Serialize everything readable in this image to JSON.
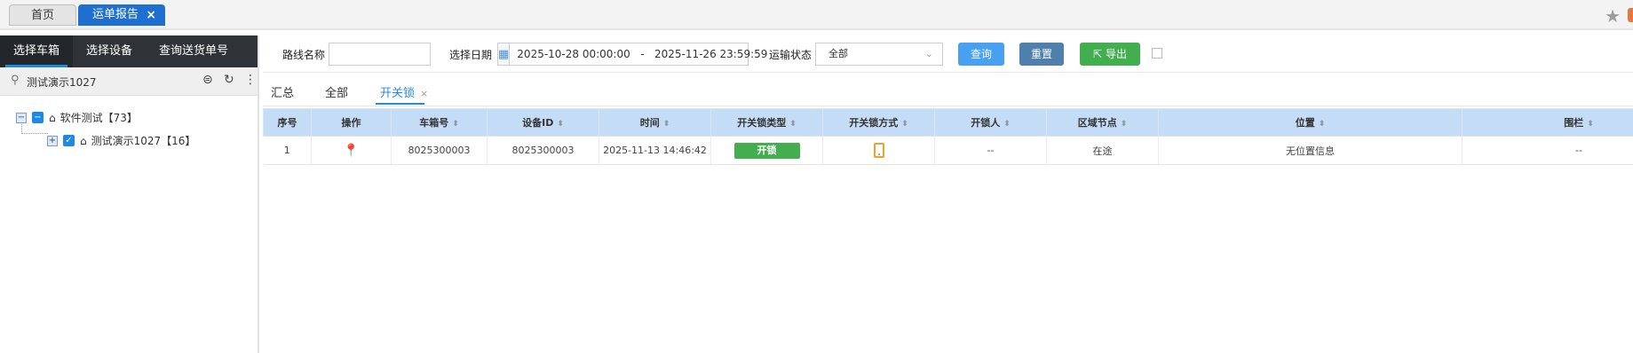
{
  "top_tabs": [
    {
      "label": "首页"
    },
    {
      "label": "运单报告",
      "close": "×"
    }
  ],
  "left": {
    "tabs": [
      "选择车箱",
      "选择设备",
      "查询送货单号"
    ],
    "search_text": "测试演示1027",
    "tree": [
      {
        "label": "软件测试【73】",
        "expander": "−",
        "check": "−"
      },
      {
        "label": "测试演示1027【16】",
        "expander": "+",
        "check": "✓"
      }
    ]
  },
  "filter": {
    "route_label": "路线名称",
    "route_value": "",
    "date_label": "选择日期",
    "date_range": "2025-10-28 00:00:00   -   2025-11-26 23:59:59",
    "status_label": "运输状态",
    "status_value": "全部",
    "query_label": "查询",
    "reset_label": "重置",
    "export_label": "导出"
  },
  "subtabs": [
    {
      "label": "汇总"
    },
    {
      "label": "全部"
    },
    {
      "label": "开关锁",
      "close": "×"
    }
  ],
  "table": {
    "columns": [
      "序号",
      "操作",
      "车箱号",
      "设备ID",
      "时间",
      "开关锁类型",
      "开关锁方式",
      "开锁人",
      "区域节点",
      "位置",
      "围栏"
    ],
    "rows": [
      {
        "no": "1",
        "box": "8025300003",
        "device": "8025300003",
        "time": "2025-11-13 14:46:42",
        "lock_type": "开锁",
        "unlocker": "--",
        "node": "在途",
        "location": "无位置信息",
        "fence": "--"
      }
    ]
  },
  "colors": {
    "accent": "#1f6fd1",
    "header_bg": "#c4dcf5",
    "badge_green": "#43ae4f",
    "query": "#48a0f0",
    "reset": "#4f7fab",
    "export": "#43ae4f"
  }
}
